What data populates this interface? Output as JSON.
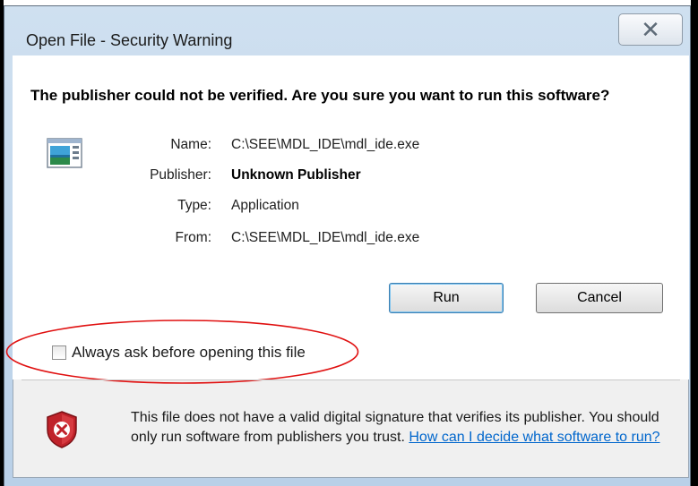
{
  "window": {
    "title": "Open File - Security Warning",
    "close_glyph": "X"
  },
  "heading": "The publisher could not be verified.  Are you sure you want to run this software?",
  "details": {
    "name_label": "Name:",
    "name_value": "C:\\SEE\\MDL_IDE\\mdl_ide.exe",
    "publisher_label": "Publisher:",
    "publisher_value": "Unknown Publisher",
    "type_label": "Type:",
    "type_value": "Application",
    "from_label": "From:",
    "from_value": "C:\\SEE\\MDL_IDE\\mdl_ide.exe"
  },
  "buttons": {
    "run": "Run",
    "cancel": "Cancel"
  },
  "checkbox": {
    "label": "Always ask before opening this file",
    "checked": false
  },
  "footer": {
    "text": "This file does not have a valid digital signature that verifies its publisher. You should only run software from publishers you trust.",
    "link": "How can I decide what software to run?"
  },
  "icons": {
    "app": "application-icon",
    "shield": "security-shield-icon",
    "annotation_color": "#e01010"
  }
}
